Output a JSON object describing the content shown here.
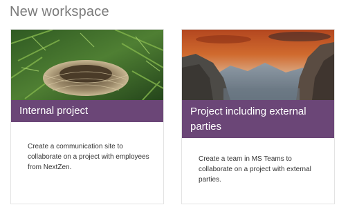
{
  "header": {
    "title": "New workspace"
  },
  "colors": {
    "banner": "#6b4677",
    "title": "#7a7a7a",
    "description": "#333333",
    "card_border": "#e3e3e3"
  },
  "cards": [
    {
      "image": "bird-nest-photo",
      "title": "Internal project",
      "description": "Create a communication site to collaborate on a project with employees from NextZen."
    },
    {
      "image": "canyon-mountains-photo",
      "title": "Project including external parties",
      "description": "Create a team in MS Teams to collaborate on a project with external parties."
    }
  ]
}
